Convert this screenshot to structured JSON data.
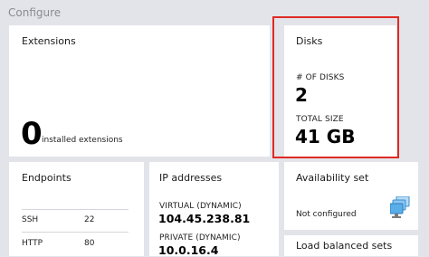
{
  "section": {
    "title": "Configure"
  },
  "extensions": {
    "title": "Extensions",
    "count": "0",
    "caption": "installed extensions"
  },
  "disks": {
    "title": "Disks",
    "count_label": "# OF DISKS",
    "count": "2",
    "size_label": "TOTAL SIZE",
    "size": "41 GB"
  },
  "endpoints": {
    "title": "Endpoints",
    "rows": [
      {
        "name": "SSH",
        "port": "22"
      },
      {
        "name": "HTTP",
        "port": "80"
      }
    ]
  },
  "ip_addresses": {
    "title": "IP addresses",
    "virtual_label": "VIRTUAL (DYNAMIC)",
    "virtual_value": "104.45.238.81",
    "private_label": "PRIVATE (DYNAMIC)",
    "private_value": "10.0.16.4"
  },
  "availability_set": {
    "title": "Availability set",
    "status": "Not configured",
    "icon": "availability-set-icon"
  },
  "load_balanced_sets": {
    "title": "Load balanced sets"
  },
  "colors": {
    "highlight": "#e02a24",
    "background": "#e3e4e9",
    "tile": "#ffffff",
    "icon_blue": "#3a8fd1"
  }
}
